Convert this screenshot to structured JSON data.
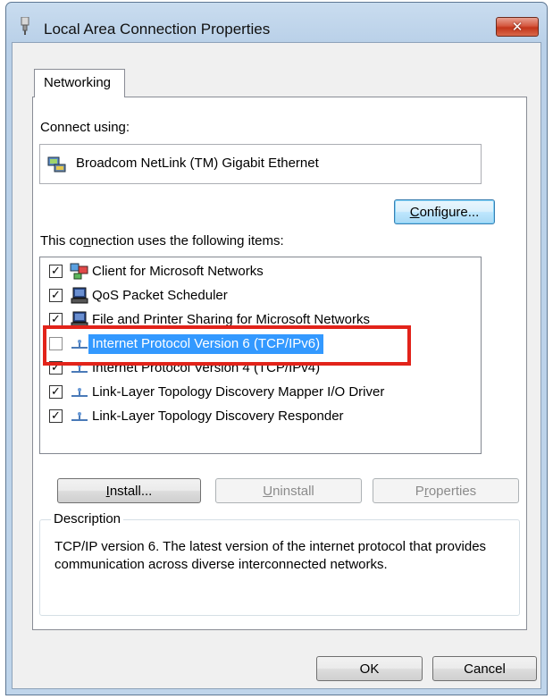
{
  "window": {
    "title": "Local Area Connection Properties",
    "close_label": "✕"
  },
  "tabs": [
    {
      "label": "Networking"
    }
  ],
  "connect_using": {
    "label": "Connect using:",
    "adapter": "Broadcom NetLink (TM) Gigabit Ethernet"
  },
  "configure_button": "Configure...",
  "items_label": "This connection uses the following items:",
  "items": [
    {
      "label": "Client for Microsoft Networks",
      "checked": true,
      "icon": "network-client-icon"
    },
    {
      "label": "QoS Packet Scheduler",
      "checked": true,
      "icon": "computer-icon"
    },
    {
      "label": "File and Printer Sharing for Microsoft Networks",
      "checked": true,
      "icon": "computer-icon"
    },
    {
      "label": "Internet Protocol Version 6 (TCP/IPv6)",
      "checked": false,
      "selected": true,
      "icon": "protocol-icon"
    },
    {
      "label": "Internet Protocol Version 4 (TCP/IPv4)",
      "checked": true,
      "icon": "protocol-icon"
    },
    {
      "label": "Link-Layer Topology Discovery Mapper I/O Driver",
      "checked": true,
      "icon": "protocol-icon"
    },
    {
      "label": "Link-Layer Topology Discovery Responder",
      "checked": true,
      "icon": "protocol-icon"
    }
  ],
  "buttons": {
    "install": "Install...",
    "uninstall": "Uninstall",
    "properties": "Properties",
    "ok": "OK",
    "cancel": "Cancel"
  },
  "description": {
    "legend": "Description",
    "text": "TCP/IP version 6. The latest version of the internet protocol that provides communication across diverse interconnected networks."
  },
  "colors": {
    "highlight_outline": "#e2231a",
    "selection": "#3399ff"
  }
}
